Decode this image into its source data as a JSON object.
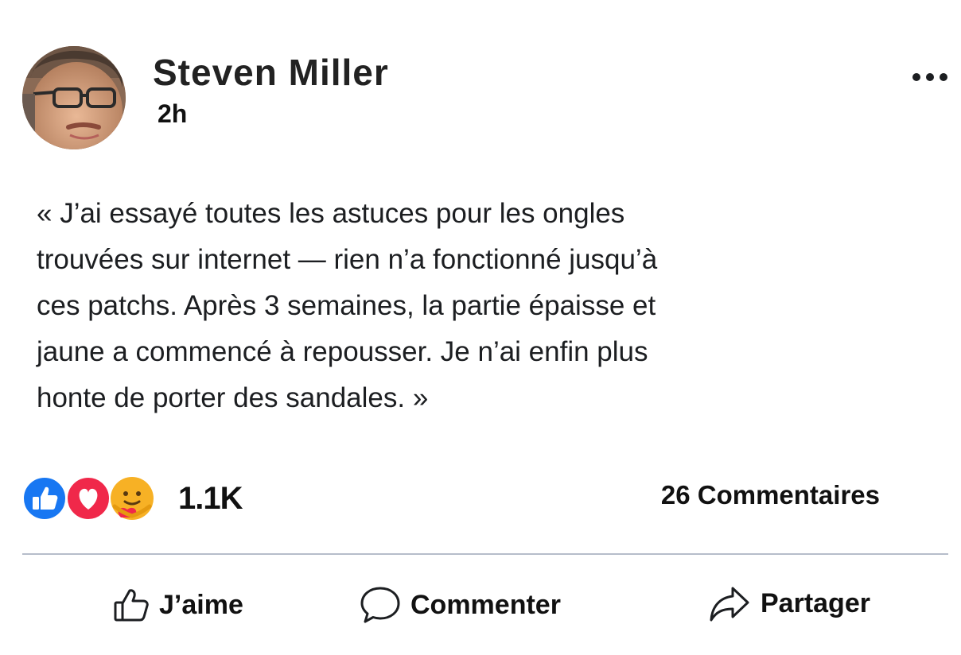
{
  "post": {
    "author": "Steven Miller",
    "time": "2h",
    "text_lines": [
      "« J’ai essayé toutes les astuces pour les ongles",
      "trouvées sur internet — rien n’a fonctionné jusqu’à",
      "ces patchs. Après 3 semaines, la partie épaisse et",
      "jaune a commencé à repousser. Je n’ai enfin plus",
      "honte de porter des sandales. »"
    ]
  },
  "reactions": {
    "icons": [
      "like-reaction-icon",
      "love-reaction-icon",
      "care-reaction-icon"
    ],
    "count": "1.1K"
  },
  "comments_count": "26 Commentaires",
  "actions": {
    "like": "J’aime",
    "comment": "Commenter",
    "share": "Partager"
  },
  "colors": {
    "like_blue": "#1877f2",
    "love_red": "#f0284a",
    "care_yellow": "#f7b125",
    "divider": "#b6bdca"
  }
}
